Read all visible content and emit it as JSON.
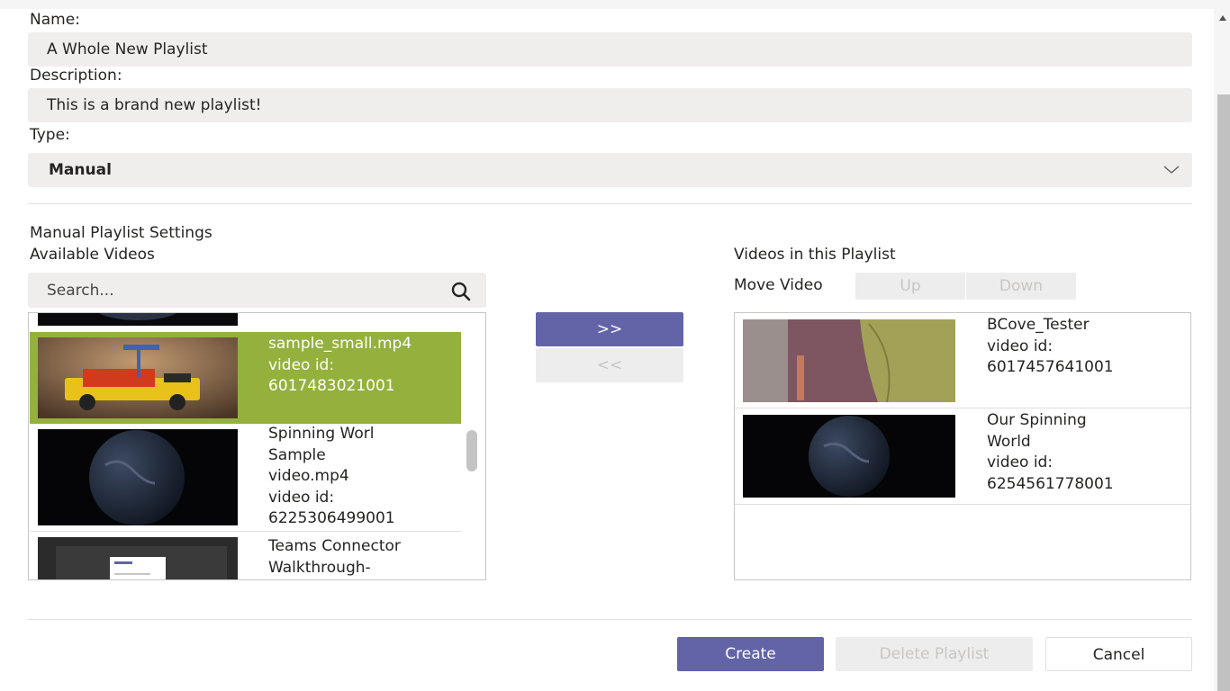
{
  "form": {
    "name_label": "Name:",
    "name_value": "A Whole New Playlist",
    "description_label": "Description:",
    "description_value": "This is a brand new playlist!",
    "type_label": "Type:",
    "type_value": "Manual",
    "type_icon": "chevron-down-icon"
  },
  "manual": {
    "section_title": "Manual Playlist Settings",
    "available_title": "Available Videos",
    "search_placeholder": "Search...",
    "search_icon": "search-icon",
    "available_videos": [
      {
        "lines": [
          "sample_small.mp4",
          "video id:",
          "6017483021001"
        ],
        "selected": true,
        "thumb": "lego-robot"
      },
      {
        "lines": [
          "Spinning Worl",
          "Sample",
          "video.mp4",
          "video id:",
          "6225306499001"
        ],
        "selected": false,
        "thumb": "earth"
      },
      {
        "lines": [
          "Teams Connector",
          "Walkthrough-"
        ],
        "selected": false,
        "thumb": "screen-recording"
      }
    ],
    "add_button": ">>",
    "remove_button": "<<",
    "playlist_title": "Videos in this Playlist",
    "move_label": "Move Video",
    "up_button": "Up",
    "down_button": "Down",
    "playlist_videos": [
      {
        "lines": [
          "BCove_Tester",
          "video id:",
          "6017457641001"
        ],
        "thumb": "person-in-jacket"
      },
      {
        "lines": [
          "Our Spinning",
          "World",
          "video id:",
          "6254561778001"
        ],
        "thumb": "earth"
      }
    ]
  },
  "footer": {
    "create_button": "Create",
    "delete_button": "Delete Playlist",
    "cancel_button": "Cancel"
  },
  "colors": {
    "primary": "#6264a7",
    "selected_row": "#93b13c",
    "field_bg": "#f0eeed",
    "disabled_bg": "#ededed"
  }
}
